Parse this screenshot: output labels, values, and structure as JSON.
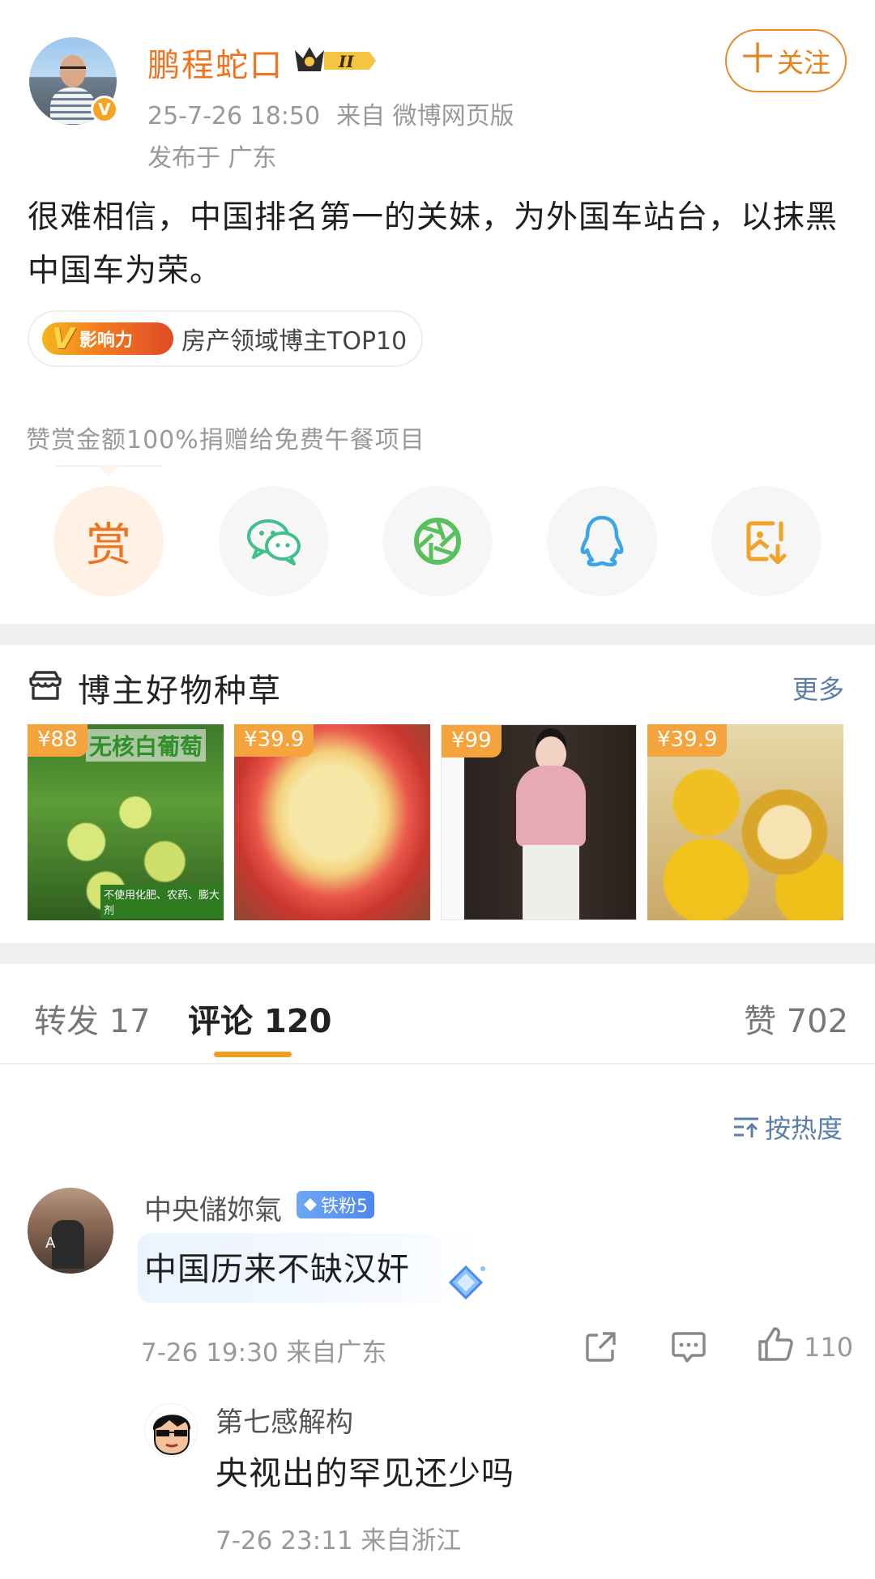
{
  "post": {
    "author": "鹏程蛇口",
    "level_badge": "II",
    "verified_mark": "V",
    "time": "25-7-26 18:50",
    "source": "来自 微博网页版",
    "location": "发布于 广东",
    "follow_label": "关注",
    "follow_plus": "十",
    "text": "很难相信，中国排名第一的关妹，为外国车站台，以抹黑中国车为荣。",
    "influence_logo": "影响力",
    "influence_v": "V",
    "influence_text": "房产领域博主TOP10",
    "donate_note": "赞赏金额100%捐赠给免费午餐项目",
    "reward_char": "赏"
  },
  "share_icons": [
    "reward-icon",
    "wechat-icon",
    "moments-icon",
    "qq-icon",
    "save-image-icon"
  ],
  "goods": {
    "title": "博主好物种草",
    "more": "更多",
    "items": [
      {
        "price": "¥88",
        "title": "无核白葡萄",
        "banner": "不使用化肥、农药、膨大剂"
      },
      {
        "price": "¥39.9"
      },
      {
        "price": "¥99"
      },
      {
        "price": "¥39.9"
      }
    ]
  },
  "tabs": {
    "repost": "转发 17",
    "comment": "评论 120",
    "like": "赞 702"
  },
  "sort_label": "按热度",
  "comments": [
    {
      "user": "中央儲妳氣",
      "badge": "铁粉5",
      "text": "中国历来不缺汉奸",
      "meta": "7-26 19:30  来自广东",
      "likes": "110"
    },
    {
      "user": "第七感解构",
      "text": "央视出的罕见还少吗",
      "meta": "7-26 23:11  来自浙江"
    }
  ],
  "colors": {
    "accent_orange": "#f0731f",
    "link_blue": "#5b7eaa",
    "tab_underline": "#f0a020"
  }
}
